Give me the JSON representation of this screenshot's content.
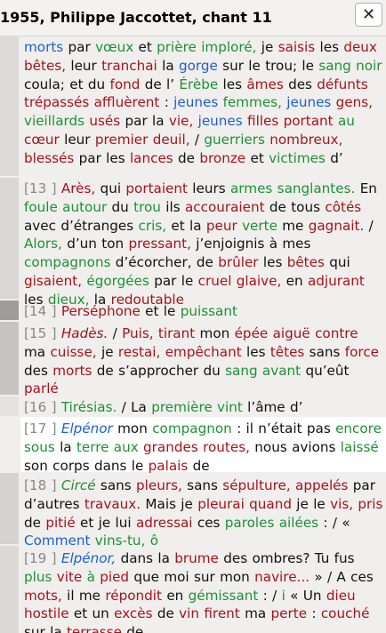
{
  "window": {
    "title": "1955, Philippe Jaccottet, chant 11",
    "close_glyph": "✕"
  },
  "colors": {
    "red": "#a8121b",
    "green": "#1f9135",
    "blue": "#1d5fd0",
    "number": "#888888"
  },
  "segments": [
    {
      "id": "seg-12",
      "number": "",
      "tokens": [
        {
          "t": "morts",
          "c": "b"
        },
        {
          "t": " par ",
          "c": "k"
        },
        {
          "t": "vœux",
          "c": "g"
        },
        {
          "t": " et ",
          "c": "k"
        },
        {
          "t": "prière",
          "c": "g"
        },
        {
          "t": " ",
          "c": "k"
        },
        {
          "t": "imploré,",
          "c": "g"
        },
        {
          "t": " je ",
          "c": "k"
        },
        {
          "t": "saisis",
          "c": "r"
        },
        {
          "t": " les ",
          "c": "k"
        },
        {
          "t": "deux",
          "c": "r"
        },
        {
          "t": " ",
          "c": "k"
        },
        {
          "t": "bêtes,",
          "c": "r"
        },
        {
          "t": " leur ",
          "c": "k"
        },
        {
          "t": "tranchai",
          "c": "r"
        },
        {
          "t": " la ",
          "c": "k"
        },
        {
          "t": "gorge",
          "c": "b"
        },
        {
          "t": " sur le trou; le ",
          "c": "k"
        },
        {
          "t": "sang",
          "c": "g"
        },
        {
          "t": " ",
          "c": "k"
        },
        {
          "t": "noir",
          "c": "g"
        },
        {
          "t": " coula; et du ",
          "c": "k"
        },
        {
          "t": "fond",
          "c": "r"
        },
        {
          "t": " de l’ ",
          "c": "k"
        },
        {
          "t": "Érèbe",
          "c": "g"
        },
        {
          "t": " les ",
          "c": "k"
        },
        {
          "t": "âmes",
          "c": "r"
        },
        {
          "t": " ",
          "c": "k"
        },
        {
          "t": "des ",
          "c": "k"
        },
        {
          "t": "défunts",
          "c": "r"
        },
        {
          "t": " ",
          "c": "k"
        },
        {
          "t": "trépassés",
          "c": "r"
        },
        {
          "t": " ",
          "c": "k"
        },
        {
          "t": "affluèrent",
          "c": "r"
        },
        {
          "t": " : ",
          "c": "k"
        },
        {
          "t": "jeunes",
          "c": "b"
        },
        {
          "t": " ",
          "c": "k"
        },
        {
          "t": "femmes,",
          "c": "g"
        },
        {
          "t": " ",
          "c": "k"
        },
        {
          "t": "jeunes",
          "c": "b"
        },
        {
          "t": " ",
          "c": "k"
        },
        {
          "t": "gens,",
          "c": "r"
        },
        {
          "t": " ",
          "c": "k"
        },
        {
          "t": "vieillards",
          "c": "g"
        },
        {
          "t": " ",
          "c": "k"
        },
        {
          "t": "usés",
          "c": "r"
        },
        {
          "t": " par la ",
          "c": "k"
        },
        {
          "t": "vie,",
          "c": "r"
        },
        {
          "t": " ",
          "c": "k"
        },
        {
          "t": "jeunes",
          "c": "b"
        },
        {
          "t": " ",
          "c": "k"
        },
        {
          "t": "filles",
          "c": "r"
        },
        {
          "t": " ",
          "c": "k"
        },
        {
          "t": "portant",
          "c": "r"
        },
        {
          "t": " ",
          "c": "k"
        },
        {
          "t": "au",
          "c": "g"
        },
        {
          "t": " ",
          "c": "k"
        },
        {
          "t": "cœur",
          "c": "r"
        },
        {
          "t": " leur ",
          "c": "k"
        },
        {
          "t": "premier",
          "c": "r"
        },
        {
          "t": " ",
          "c": "k"
        },
        {
          "t": "deuil,",
          "c": "r"
        },
        {
          "t": " / ",
          "c": "k"
        },
        {
          "t": "guerriers",
          "c": "g"
        },
        {
          "t": " ",
          "c": "k"
        },
        {
          "t": "nombreux,",
          "c": "r"
        },
        {
          "t": " ",
          "c": "k"
        },
        {
          "t": "blessés",
          "c": "r"
        },
        {
          "t": " par les ",
          "c": "k"
        },
        {
          "t": "lances",
          "c": "r"
        },
        {
          "t": " de ",
          "c": "k"
        },
        {
          "t": "bronze",
          "c": "r"
        },
        {
          "t": " et ",
          "c": "k"
        },
        {
          "t": "victimes",
          "c": "g"
        },
        {
          "t": " d’",
          "c": "k"
        }
      ]
    },
    {
      "id": "seg-13",
      "number": "[13 ]",
      "tokens": [
        {
          "t": "Arès,",
          "c": "r"
        },
        {
          "t": " qui ",
          "c": "k"
        },
        {
          "t": "portaient",
          "c": "r"
        },
        {
          "t": " leurs ",
          "c": "k"
        },
        {
          "t": "armes",
          "c": "g"
        },
        {
          "t": " ",
          "c": "k"
        },
        {
          "t": "sanglantes.",
          "c": "g"
        },
        {
          "t": " ",
          "c": "k"
        },
        {
          "t": "En ",
          "c": "k"
        },
        {
          "t": "foule",
          "c": "g"
        },
        {
          "t": " ",
          "c": "k"
        },
        {
          "t": "autour",
          "c": "g"
        },
        {
          "t": " du ",
          "c": "k"
        },
        {
          "t": "trou",
          "c": "g"
        },
        {
          "t": " ils ",
          "c": "k"
        },
        {
          "t": "accouraient",
          "c": "r"
        },
        {
          "t": " de tous ",
          "c": "k"
        },
        {
          "t": "côtés",
          "c": "r"
        },
        {
          "t": " avec d’étranges ",
          "c": "k"
        },
        {
          "t": "cris,",
          "c": "g"
        },
        {
          "t": " et la ",
          "c": "k"
        },
        {
          "t": "peur",
          "c": "r"
        },
        {
          "t": " ",
          "c": "k"
        },
        {
          "t": "verte",
          "c": "g"
        },
        {
          "t": " me ",
          "c": "k"
        },
        {
          "t": "gagnait.",
          "c": "r"
        },
        {
          "t": " / ",
          "c": "k"
        },
        {
          "t": "Alors,",
          "c": "g"
        },
        {
          "t": " d’un ton ",
          "c": "k"
        },
        {
          "t": "pressant,",
          "c": "r"
        },
        {
          "t": " j’enjoignis à ",
          "c": "k"
        },
        {
          "t": "mes ",
          "c": "k"
        },
        {
          "t": "compagnons",
          "c": "g"
        },
        {
          "t": " d’écorcher, de ",
          "c": "k"
        },
        {
          "t": "brûler",
          "c": "r"
        },
        {
          "t": " les ",
          "c": "k"
        },
        {
          "t": "bêtes",
          "c": "r"
        },
        {
          "t": " ",
          "c": "k"
        },
        {
          "t": "qui ",
          "c": "k"
        },
        {
          "t": "gisaient,",
          "c": "r"
        },
        {
          "t": " ",
          "c": "k"
        },
        {
          "t": "égorgées",
          "c": "g"
        },
        {
          "t": " par le ",
          "c": "k"
        },
        {
          "t": "cruel",
          "c": "r"
        },
        {
          "t": " ",
          "c": "k"
        },
        {
          "t": "glaive,",
          "c": "r"
        },
        {
          "t": " en ",
          "c": "k"
        },
        {
          "t": "adjurant",
          "c": "r"
        },
        {
          "t": " les ",
          "c": "k"
        },
        {
          "t": "dieux,",
          "c": "g"
        },
        {
          "t": " la ",
          "c": "k"
        },
        {
          "t": "redoutable",
          "c": "r"
        }
      ]
    },
    {
      "id": "seg-14",
      "number": "[14 ]",
      "tokens": [
        {
          "t": "Perséphone",
          "c": "r"
        },
        {
          "t": " et le ",
          "c": "k"
        },
        {
          "t": "puissant",
          "c": "g"
        }
      ]
    },
    {
      "id": "seg-15",
      "number": "[15 ]",
      "tokens": [
        {
          "t": "Hadès.",
          "c": "r",
          "i": true
        },
        {
          "t": " / ",
          "c": "k"
        },
        {
          "t": "Puis,",
          "c": "r"
        },
        {
          "t": " ",
          "c": "k"
        },
        {
          "t": "tirant",
          "c": "r"
        },
        {
          "t": " mon ",
          "c": "k"
        },
        {
          "t": "épée",
          "c": "r"
        },
        {
          "t": " ",
          "c": "k"
        },
        {
          "t": "aiguë",
          "c": "r"
        },
        {
          "t": " ",
          "c": "k"
        },
        {
          "t": "contre",
          "c": "r"
        },
        {
          "t": " ",
          "c": "k"
        },
        {
          "t": "ma ",
          "c": "k"
        },
        {
          "t": "cuisse,",
          "c": "r"
        },
        {
          "t": " je ",
          "c": "k"
        },
        {
          "t": "restai,",
          "c": "r"
        },
        {
          "t": " ",
          "c": "k"
        },
        {
          "t": "empêchant",
          "c": "r"
        },
        {
          "t": " les ",
          "c": "k"
        },
        {
          "t": "têtes",
          "c": "r"
        },
        {
          "t": " sans ",
          "c": "k"
        },
        {
          "t": "force",
          "c": "r"
        },
        {
          "t": " des ",
          "c": "k"
        },
        {
          "t": "morts",
          "c": "r"
        },
        {
          "t": " de s’approcher du ",
          "c": "k"
        },
        {
          "t": "sang",
          "c": "g"
        },
        {
          "t": " ",
          "c": "k"
        },
        {
          "t": "avant",
          "c": "g"
        },
        {
          "t": " ",
          "c": "k"
        },
        {
          "t": "qu’eût ",
          "c": "k"
        },
        {
          "t": "parlé",
          "c": "r"
        }
      ]
    },
    {
      "id": "seg-16",
      "number": "[16 ]",
      "tokens": [
        {
          "t": "Tirésias.",
          "c": "g"
        },
        {
          "t": " / La ",
          "c": "k"
        },
        {
          "t": "première",
          "c": "g"
        },
        {
          "t": " ",
          "c": "k"
        },
        {
          "t": "vint",
          "c": "g"
        },
        {
          "t": " l’âme d’",
          "c": "k"
        }
      ]
    },
    {
      "id": "seg-17",
      "number": "[17 ]",
      "tokens": [
        {
          "t": "Elpénor",
          "c": "b",
          "i": true
        },
        {
          "t": " mon ",
          "c": "k"
        },
        {
          "t": "compagnon",
          "c": "g"
        },
        {
          "t": " : il n’était pas ",
          "c": "k"
        },
        {
          "t": "encore",
          "c": "g"
        },
        {
          "t": " ",
          "c": "k"
        },
        {
          "t": "sous",
          "c": "g"
        },
        {
          "t": " la ",
          "c": "k"
        },
        {
          "t": "terre",
          "c": "g"
        },
        {
          "t": " ",
          "c": "k"
        },
        {
          "t": "aux",
          "c": "g"
        },
        {
          "t": " ",
          "c": "k"
        },
        {
          "t": "grandes",
          "c": "r"
        },
        {
          "t": " ",
          "c": "k"
        },
        {
          "t": "routes,",
          "c": "r"
        },
        {
          "t": " nous ",
          "c": "k"
        },
        {
          "t": "avions ",
          "c": "k"
        },
        {
          "t": "laissé",
          "c": "g"
        },
        {
          "t": " son ",
          "c": "k"
        },
        {
          "t": "corps",
          "c": "k"
        },
        {
          "t": " dans le ",
          "c": "k"
        },
        {
          "t": "palais",
          "c": "r"
        },
        {
          "t": " de",
          "c": "k"
        }
      ]
    },
    {
      "id": "seg-18",
      "number": "[18 ]",
      "tokens": [
        {
          "t": "Circé",
          "c": "g",
          "i": true
        },
        {
          "t": " sans ",
          "c": "k"
        },
        {
          "t": "pleurs,",
          "c": "r"
        },
        {
          "t": " sans ",
          "c": "k"
        },
        {
          "t": "sépulture,",
          "c": "r"
        },
        {
          "t": " ",
          "c": "k"
        },
        {
          "t": "appelés",
          "c": "r"
        },
        {
          "t": " ",
          "c": "k"
        },
        {
          "t": "par d’autres ",
          "c": "k"
        },
        {
          "t": "travaux.",
          "c": "r"
        },
        {
          "t": " Mais je ",
          "c": "k"
        },
        {
          "t": "pleurai",
          "c": "r"
        },
        {
          "t": " ",
          "c": "k"
        },
        {
          "t": "quand",
          "c": "r"
        },
        {
          "t": " je le ",
          "c": "k"
        },
        {
          "t": "vis,",
          "c": "r"
        },
        {
          "t": " ",
          "c": "k"
        },
        {
          "t": "pris",
          "c": "r"
        },
        {
          "t": " de ",
          "c": "k"
        },
        {
          "t": "pitié",
          "c": "r"
        },
        {
          "t": " et je lui ",
          "c": "k"
        },
        {
          "t": "adressai",
          "c": "r"
        },
        {
          "t": " ces ",
          "c": "k"
        },
        {
          "t": "paroles",
          "c": "g"
        },
        {
          "t": " ",
          "c": "k"
        },
        {
          "t": "ailées",
          "c": "g"
        },
        {
          "t": " : / « ",
          "c": "k"
        },
        {
          "t": "Comment",
          "c": "b"
        },
        {
          "t": " ",
          "c": "k"
        },
        {
          "t": "vins-tu,",
          "c": "g"
        },
        {
          "t": " ",
          "c": "k"
        },
        {
          "t": "ô",
          "c": "g"
        }
      ]
    },
    {
      "id": "seg-19",
      "number": "[19 ]",
      "tokens": [
        {
          "t": "Elpénor,",
          "c": "b",
          "i": true
        },
        {
          "t": " dans la ",
          "c": "k"
        },
        {
          "t": "brume",
          "c": "r"
        },
        {
          "t": " des ombres? Tu fus ",
          "c": "k"
        },
        {
          "t": "plus",
          "c": "g"
        },
        {
          "t": " ",
          "c": "k"
        },
        {
          "t": "vite",
          "c": "r"
        },
        {
          "t": " ",
          "c": "k"
        },
        {
          "t": "à",
          "c": "g"
        },
        {
          "t": " ",
          "c": "k"
        },
        {
          "t": "pied",
          "c": "r"
        },
        {
          "t": " que moi sur mon ",
          "c": "k"
        },
        {
          "t": "navire...",
          "c": "r"
        },
        {
          "t": " » / A ",
          "c": "k"
        },
        {
          "t": "ces ",
          "c": "k"
        },
        {
          "t": "mots,",
          "c": "r"
        },
        {
          "t": " il me ",
          "c": "k"
        },
        {
          "t": "répondit",
          "c": "r"
        },
        {
          "t": " en ",
          "c": "k"
        },
        {
          "t": "gémissant",
          "c": "g"
        },
        {
          "t": " : / ",
          "c": "k"
        },
        {
          "t": "i",
          "c": "g"
        },
        {
          "t": " « Un ",
          "c": "k"
        },
        {
          "t": "dieu",
          "c": "r"
        },
        {
          "t": " ",
          "c": "k"
        },
        {
          "t": "hostile",
          "c": "r"
        },
        {
          "t": " et un ",
          "c": "k"
        },
        {
          "t": "excès",
          "c": "r"
        },
        {
          "t": " de ",
          "c": "k"
        },
        {
          "t": "vin",
          "c": "r"
        },
        {
          "t": " ",
          "c": "k"
        },
        {
          "t": "firent",
          "c": "r"
        },
        {
          "t": " ma ",
          "c": "k"
        },
        {
          "t": "perte",
          "c": "r"
        },
        {
          "t": " : ",
          "c": "k"
        },
        {
          "t": "couché",
          "c": "r"
        },
        {
          "t": " sur la ",
          "c": "k"
        },
        {
          "t": "terrasse",
          "c": "r"
        },
        {
          "t": " de",
          "c": "k"
        }
      ]
    }
  ]
}
